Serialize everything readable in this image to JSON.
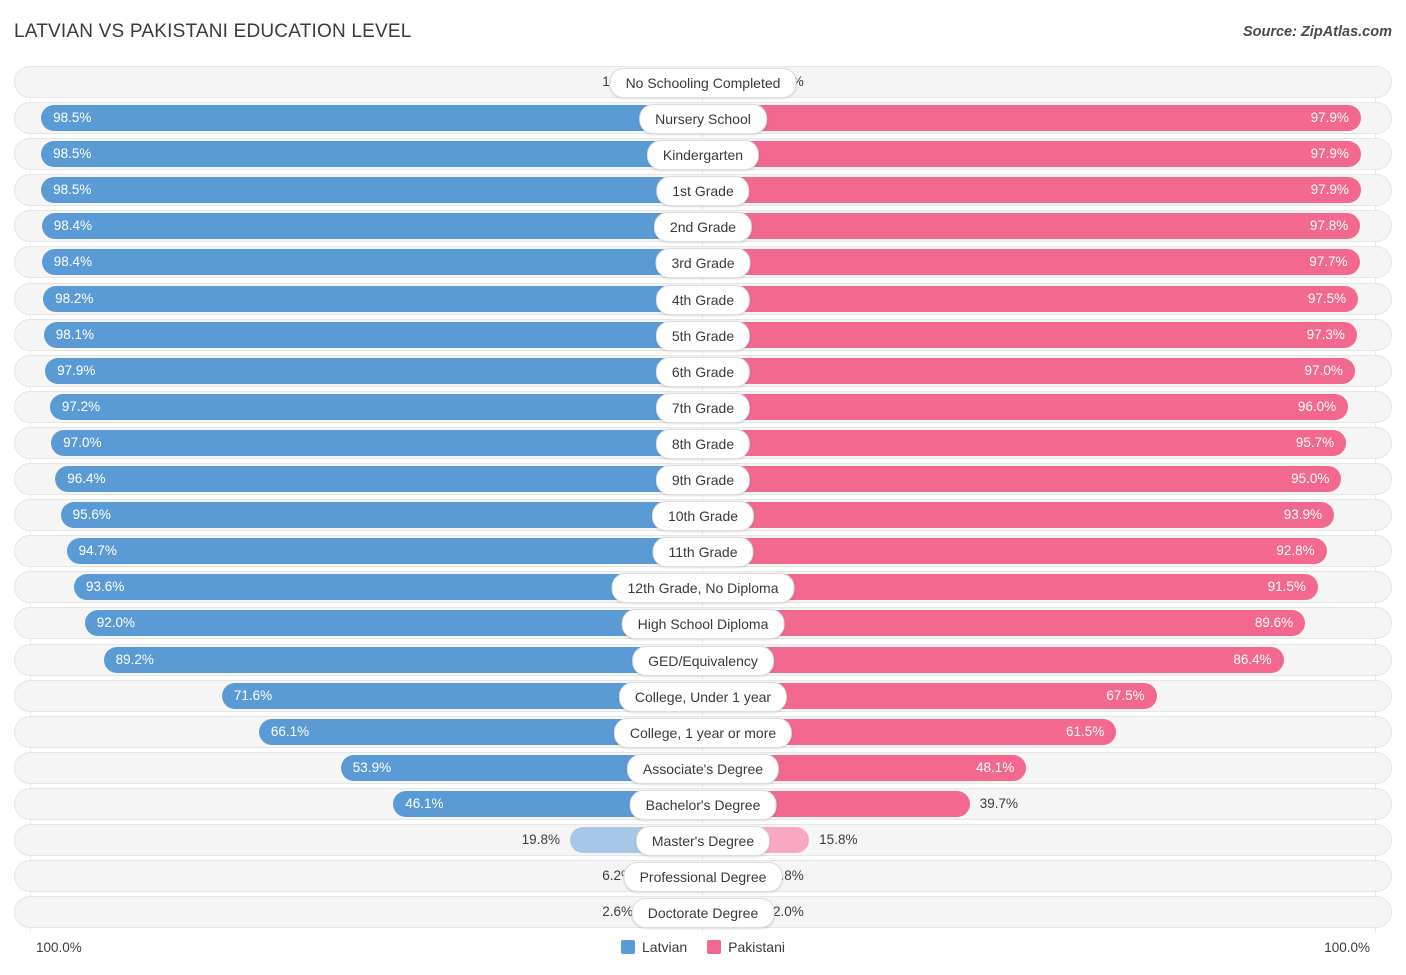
{
  "header": {
    "title": "LATVIAN VS PAKISTANI EDUCATION LEVEL",
    "source": "Source: ZipAtlas.com"
  },
  "legend": {
    "left_name": "Latvian",
    "right_name": "Pakistani",
    "left_color": "#5b9bd5",
    "right_color": "#f2688f"
  },
  "axis": {
    "left_max": "100.0%",
    "right_max": "100.0%"
  },
  "chart_data": {
    "type": "bar",
    "title": "LATVIAN VS PAKISTANI EDUCATION LEVEL",
    "orientation": "horizontal-diverging",
    "xlabel": "",
    "ylabel": "",
    "xlim": [
      0,
      100
    ],
    "grid": true,
    "legend_position": "bottom-center",
    "categories": [
      "No Schooling Completed",
      "Nursery School",
      "Kindergarten",
      "1st Grade",
      "2nd Grade",
      "3rd Grade",
      "4th Grade",
      "5th Grade",
      "6th Grade",
      "7th Grade",
      "8th Grade",
      "9th Grade",
      "10th Grade",
      "11th Grade",
      "12th Grade, No Diploma",
      "High School Diploma",
      "GED/Equivalency",
      "College, Under 1 year",
      "College, 1 year or more",
      "Associate's Degree",
      "Bachelor's Degree",
      "Master's Degree",
      "Professional Degree",
      "Doctorate Degree"
    ],
    "series": [
      {
        "name": "Latvian",
        "color": "#5b9bd5",
        "values": [
          1.5,
          98.5,
          98.5,
          98.5,
          98.4,
          98.4,
          98.2,
          98.1,
          97.9,
          97.2,
          97.0,
          96.4,
          95.6,
          94.7,
          93.6,
          92.0,
          89.2,
          71.6,
          66.1,
          53.9,
          46.1,
          19.8,
          6.2,
          2.6
        ],
        "labels": [
          "1.5%",
          "98.5%",
          "98.5%",
          "98.5%",
          "98.4%",
          "98.4%",
          "98.2%",
          "98.1%",
          "97.9%",
          "97.2%",
          "97.0%",
          "96.4%",
          "95.6%",
          "94.7%",
          "93.6%",
          "92.0%",
          "89.2%",
          "71.6%",
          "66.1%",
          "53.9%",
          "46.1%",
          "19.8%",
          "6.2%",
          "2.6%"
        ]
      },
      {
        "name": "Pakistani",
        "color": "#f2688f",
        "values": [
          2.1,
          97.9,
          97.9,
          97.9,
          97.8,
          97.7,
          97.5,
          97.3,
          97.0,
          96.0,
          95.7,
          95.0,
          93.9,
          92.8,
          91.5,
          89.6,
          86.4,
          67.5,
          61.5,
          48.1,
          39.7,
          15.8,
          4.8,
          2.0
        ],
        "labels": [
          "2.1%",
          "97.9%",
          "97.9%",
          "97.9%",
          "97.8%",
          "97.7%",
          "97.5%",
          "97.3%",
          "97.0%",
          "96.0%",
          "95.7%",
          "95.0%",
          "93.9%",
          "92.8%",
          "91.5%",
          "89.6%",
          "86.4%",
          "67.5%",
          "61.5%",
          "48.1%",
          "39.7%",
          "15.8%",
          "4.8%",
          "2.0%"
        ]
      }
    ]
  }
}
